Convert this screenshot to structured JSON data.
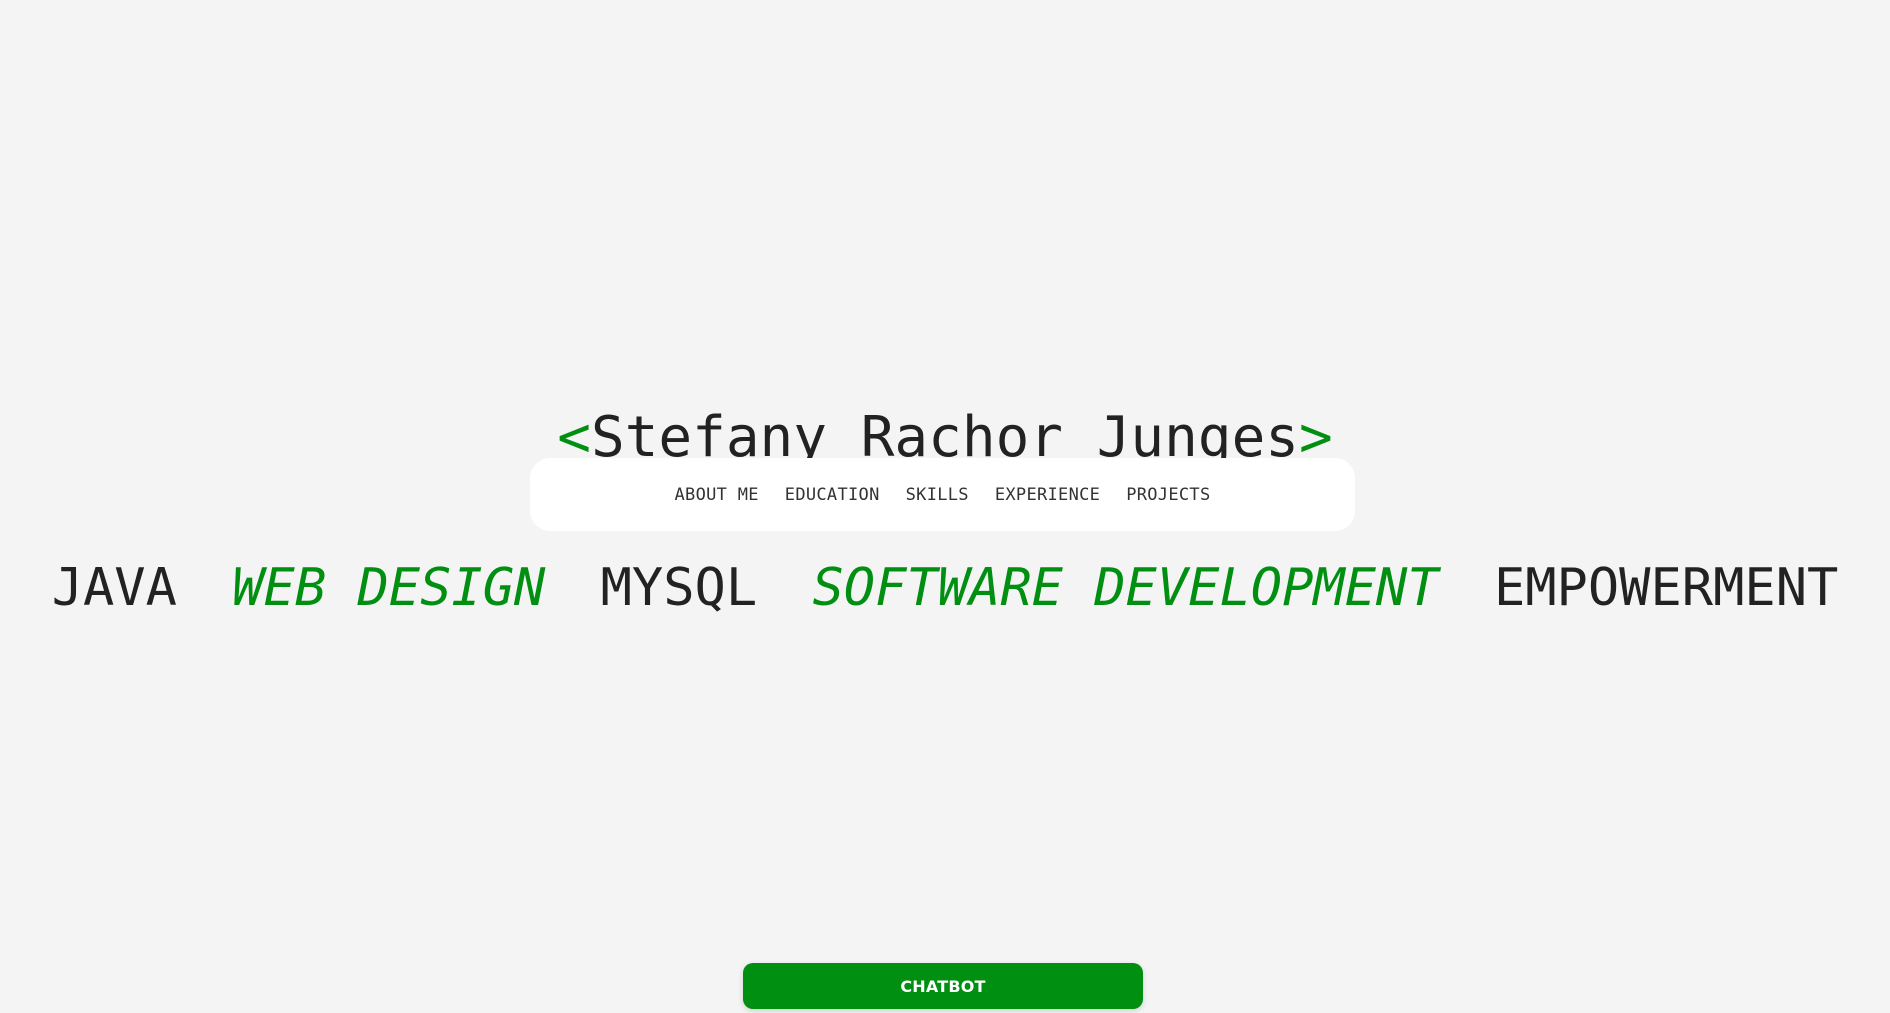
{
  "header": {
    "open_bracket": "<",
    "name": "Stefany Rachor Junges",
    "close_bracket": ">"
  },
  "nav": {
    "items": [
      {
        "label": "ABOUT ME"
      },
      {
        "label": "EDUCATION"
      },
      {
        "label": "SKILLS"
      },
      {
        "label": "EXPERIENCE"
      },
      {
        "label": "PROJECTS"
      }
    ]
  },
  "skills_banner": [
    {
      "label": "JAVA",
      "style": "plain"
    },
    {
      "label": "WEB DESIGN",
      "style": "accent"
    },
    {
      "label": "MYSQL",
      "style": "plain"
    },
    {
      "label": "SOFTWARE DEVELOPMENT",
      "style": "accent"
    },
    {
      "label": "EMPOWERMENT",
      "style": "plain"
    }
  ],
  "chatbot": {
    "label": "CHATBOT"
  },
  "colors": {
    "accent": "#008f11",
    "text": "#222222",
    "background": "#f4f4f4",
    "nav_background": "#ffffff"
  }
}
